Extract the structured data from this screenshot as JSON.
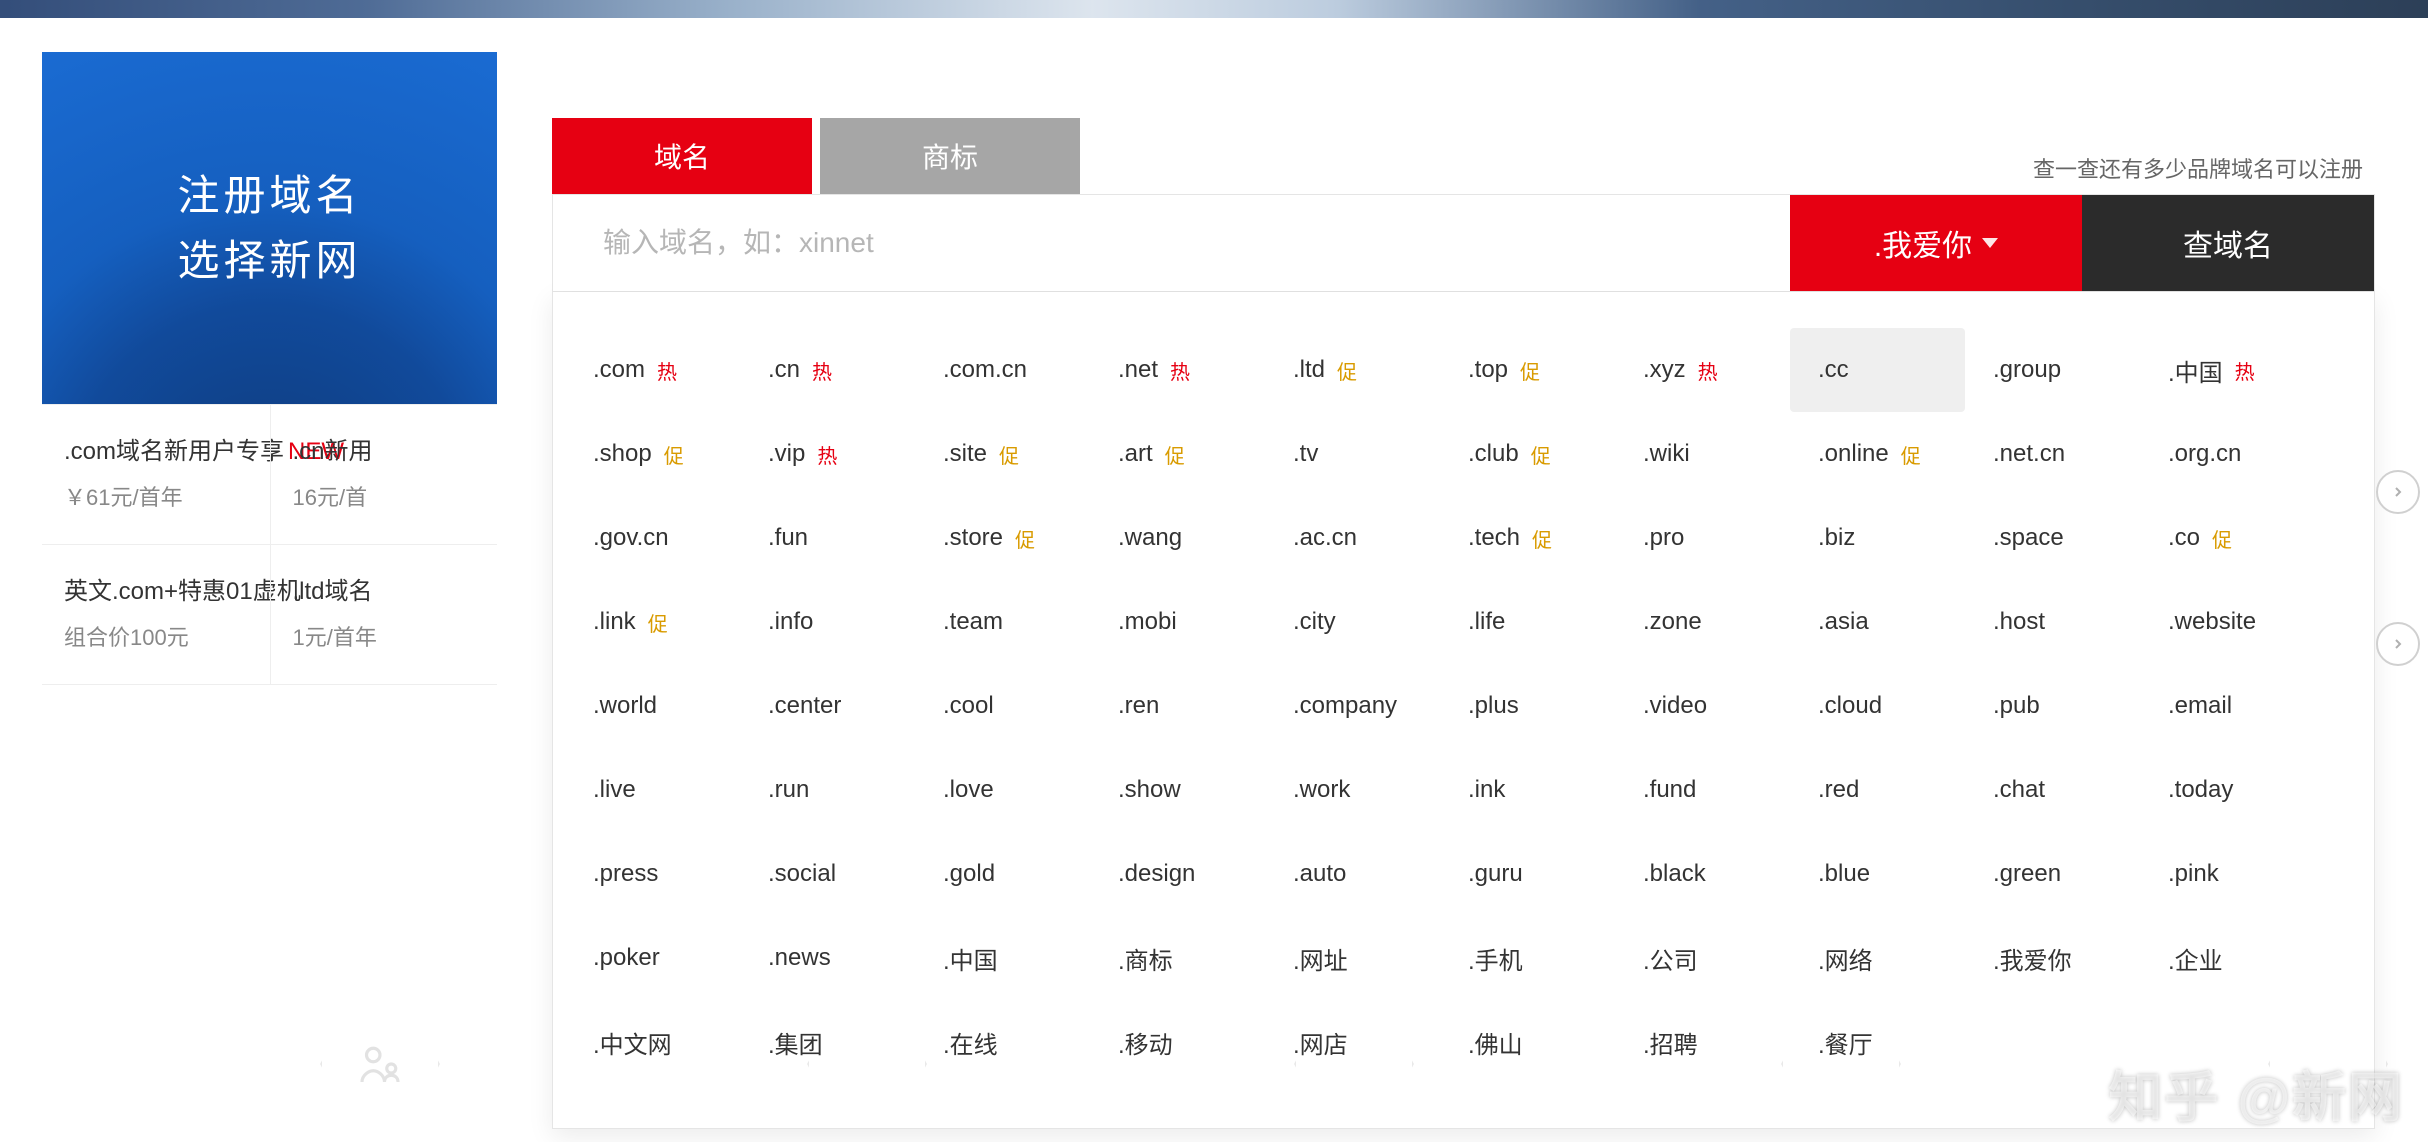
{
  "hero": {
    "line1": "注册域名",
    "line2": "选择新网"
  },
  "promo_grid": [
    [
      {
        "title": ".com域名新用户专享",
        "tag": "NEW",
        "sub": "￥61元/首年"
      },
      {
        "title": ".cn新用",
        "tag": "",
        "sub": "16元/首"
      }
    ],
    [
      {
        "title": "英文.com+特惠01虚机",
        "tag": "",
        "sub": "组合价100元"
      },
      {
        "title": ".ltd域名",
        "tag": "",
        "sub": "1元/首年"
      }
    ]
  ],
  "tabs": {
    "active": "域名",
    "inactive": "商标",
    "right_note": "查一查还有多少品牌域名可以注册"
  },
  "search": {
    "placeholder": "输入域名，如：xinnet",
    "selected_tld": ".我爱你",
    "button_label": "查域名"
  },
  "badge_labels": {
    "hot": "热",
    "promo": "促"
  },
  "tld_rows": [
    [
      {
        "name": ".com",
        "badge": "hot"
      },
      {
        "name": ".cn",
        "badge": "hot"
      },
      {
        "name": ".com.cn",
        "badge": ""
      },
      {
        "name": ".net",
        "badge": "hot"
      },
      {
        "name": ".ltd",
        "badge": "promo"
      },
      {
        "name": ".top",
        "badge": "promo"
      },
      {
        "name": ".xyz",
        "badge": "hot"
      },
      {
        "name": ".cc",
        "badge": "",
        "highlight": true
      },
      {
        "name": ".group",
        "badge": ""
      },
      {
        "name": ".中国",
        "badge": "hot"
      }
    ],
    [
      {
        "name": ".shop",
        "badge": "promo"
      },
      {
        "name": ".vip",
        "badge": "hot"
      },
      {
        "name": ".site",
        "badge": "promo"
      },
      {
        "name": ".art",
        "badge": "promo"
      },
      {
        "name": ".tv",
        "badge": ""
      },
      {
        "name": ".club",
        "badge": "promo"
      },
      {
        "name": ".wiki",
        "badge": ""
      },
      {
        "name": ".online",
        "badge": "promo"
      },
      {
        "name": ".net.cn",
        "badge": ""
      },
      {
        "name": ".org.cn",
        "badge": ""
      }
    ],
    [
      {
        "name": ".gov.cn",
        "badge": ""
      },
      {
        "name": ".fun",
        "badge": ""
      },
      {
        "name": ".store",
        "badge": "promo"
      },
      {
        "name": ".wang",
        "badge": ""
      },
      {
        "name": ".ac.cn",
        "badge": ""
      },
      {
        "name": ".tech",
        "badge": "promo"
      },
      {
        "name": ".pro",
        "badge": ""
      },
      {
        "name": ".biz",
        "badge": ""
      },
      {
        "name": ".space",
        "badge": ""
      },
      {
        "name": ".co",
        "badge": "promo"
      }
    ],
    [
      {
        "name": ".link",
        "badge": "promo"
      },
      {
        "name": ".info",
        "badge": ""
      },
      {
        "name": ".team",
        "badge": ""
      },
      {
        "name": ".mobi",
        "badge": ""
      },
      {
        "name": ".city",
        "badge": ""
      },
      {
        "name": ".life",
        "badge": ""
      },
      {
        "name": ".zone",
        "badge": ""
      },
      {
        "name": ".asia",
        "badge": ""
      },
      {
        "name": ".host",
        "badge": ""
      },
      {
        "name": ".website",
        "badge": ""
      }
    ],
    [
      {
        "name": ".world",
        "badge": ""
      },
      {
        "name": ".center",
        "badge": ""
      },
      {
        "name": ".cool",
        "badge": ""
      },
      {
        "name": ".ren",
        "badge": ""
      },
      {
        "name": ".company",
        "badge": ""
      },
      {
        "name": ".plus",
        "badge": ""
      },
      {
        "name": ".video",
        "badge": ""
      },
      {
        "name": ".cloud",
        "badge": ""
      },
      {
        "name": ".pub",
        "badge": ""
      },
      {
        "name": ".email",
        "badge": ""
      }
    ],
    [
      {
        "name": ".live",
        "badge": ""
      },
      {
        "name": ".run",
        "badge": ""
      },
      {
        "name": ".love",
        "badge": ""
      },
      {
        "name": ".show",
        "badge": ""
      },
      {
        "name": ".work",
        "badge": ""
      },
      {
        "name": ".ink",
        "badge": ""
      },
      {
        "name": ".fund",
        "badge": ""
      },
      {
        "name": ".red",
        "badge": ""
      },
      {
        "name": ".chat",
        "badge": ""
      },
      {
        "name": ".today",
        "badge": ""
      }
    ],
    [
      {
        "name": ".press",
        "badge": ""
      },
      {
        "name": ".social",
        "badge": ""
      },
      {
        "name": ".gold",
        "badge": ""
      },
      {
        "name": ".design",
        "badge": ""
      },
      {
        "name": ".auto",
        "badge": ""
      },
      {
        "name": ".guru",
        "badge": ""
      },
      {
        "name": ".black",
        "badge": ""
      },
      {
        "name": ".blue",
        "badge": ""
      },
      {
        "name": ".green",
        "badge": ""
      },
      {
        "name": ".pink",
        "badge": ""
      }
    ],
    [
      {
        "name": ".poker",
        "badge": ""
      },
      {
        "name": ".news",
        "badge": ""
      },
      {
        "name": ".中国",
        "badge": ""
      },
      {
        "name": ".商标",
        "badge": ""
      },
      {
        "name": ".网址",
        "badge": ""
      },
      {
        "name": ".手机",
        "badge": ""
      },
      {
        "name": ".公司",
        "badge": ""
      },
      {
        "name": ".网络",
        "badge": ""
      },
      {
        "name": ".我爱你",
        "badge": ""
      },
      {
        "name": ".企业",
        "badge": ""
      }
    ],
    [
      {
        "name": ".中文网",
        "badge": ""
      },
      {
        "name": ".集团",
        "badge": ""
      },
      {
        "name": ".在线",
        "badge": ""
      },
      {
        "name": ".移动",
        "badge": ""
      },
      {
        "name": ".网店",
        "badge": ""
      },
      {
        "name": ".佛山",
        "badge": ""
      },
      {
        "name": ".招聘",
        "badge": ""
      },
      {
        "name": ".餐厅",
        "badge": ""
      }
    ]
  ],
  "watermark": "知乎 @新网"
}
